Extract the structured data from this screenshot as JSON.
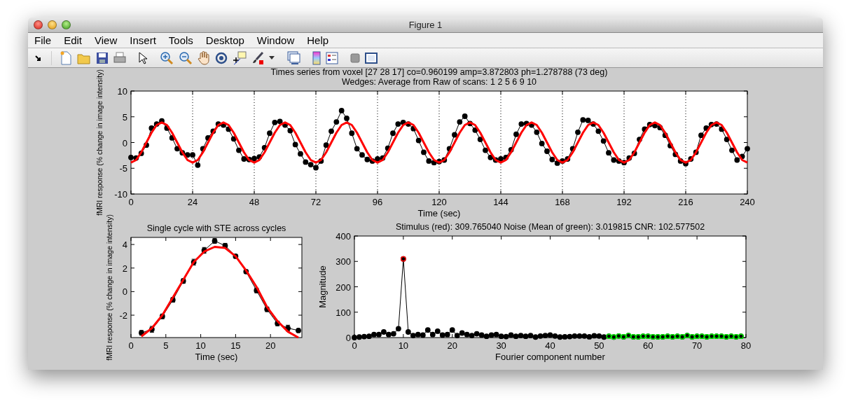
{
  "window": {
    "title": "Figure 1"
  },
  "menu": [
    "File",
    "Edit",
    "View",
    "Insert",
    "Tools",
    "Desktop",
    "Window",
    "Help"
  ],
  "figure": {
    "plots": [
      {
        "chart_data": {
          "type": "line",
          "title": [
            "Times series from voxel [27 28 17]  co=0.960199 amp=3.872803 ph=1.278788 (73 deg)",
            "Wedges: Average from Raw of scans: 1   2   5   6   9  10"
          ],
          "xlabel": "Time (sec)",
          "ylabel": "fMRI response (% change in image intensity)",
          "grid": "x",
          "xlim": [
            0,
            240
          ],
          "ylim": [
            -10,
            10
          ],
          "xticks": [
            0,
            24,
            48,
            72,
            96,
            120,
            144,
            168,
            192,
            216,
            240
          ],
          "yticks": [
            -10,
            -5,
            0,
            5,
            10
          ],
          "x": [
            0,
            2,
            4,
            6,
            8,
            10,
            12,
            14,
            16,
            18,
            20,
            22,
            24,
            26,
            28,
            30,
            32,
            34,
            36,
            38,
            40,
            42,
            44,
            46,
            48,
            50,
            52,
            54,
            56,
            58,
            60,
            62,
            64,
            66,
            68,
            70,
            72,
            74,
            76,
            78,
            80,
            82,
            84,
            86,
            88,
            90,
            92,
            94,
            96,
            98,
            100,
            102,
            104,
            106,
            108,
            110,
            112,
            114,
            116,
            118,
            120,
            122,
            124,
            126,
            128,
            130,
            132,
            134,
            136,
            138,
            140,
            142,
            144,
            146,
            148,
            150,
            152,
            154,
            156,
            158,
            160,
            162,
            164,
            166,
            168,
            170,
            172,
            174,
            176,
            178,
            180,
            182,
            184,
            186,
            188,
            190,
            192,
            194,
            196,
            198,
            200,
            202,
            204,
            206,
            208,
            210,
            212,
            214,
            216,
            218,
            220,
            222,
            224,
            226,
            228,
            230,
            232,
            234,
            236,
            238,
            240
          ],
          "series": [
            {
              "color": "#000000",
              "marker": "circle",
              "values": [
                -2.9,
                -3.0,
                -2.1,
                -0.5,
                2.8,
                3.6,
                4.2,
                2.8,
                0.9,
                -1.2,
                -2.0,
                -2.4,
                -2.4,
                -4.4,
                -1.2,
                0.9,
                2.2,
                3.6,
                3.4,
                2.6,
                0.7,
                -1.5,
                -3.2,
                -3.3,
                -3.1,
                -2.8,
                -1.0,
                1.8,
                3.9,
                4.1,
                3.4,
                2.3,
                -0.4,
                -2.2,
                -3.8,
                -4.3,
                -4.9,
                -3.6,
                -0.5,
                2.2,
                4.0,
                6.2,
                4.7,
                1.8,
                -1.2,
                -2.4,
                -3.3,
                -3.6,
                -3.2,
                -3.0,
                -1.1,
                1.8,
                3.6,
                3.9,
                3.6,
                2.7,
                0.4,
                -1.9,
                -3.6,
                -3.9,
                -3.7,
                -3.4,
                -1.2,
                1.5,
                4.0,
                5.1,
                3.7,
                2.4,
                0.6,
                -1.5,
                -2.9,
                -3.4,
                -3.2,
                -2.9,
                -1.4,
                1.6,
                3.6,
                3.7,
                3.4,
                2.0,
                -0.2,
                -1.7,
                -3.3,
                -4.0,
                -3.6,
                -3.2,
                -1.2,
                2.0,
                4.4,
                4.3,
                3.6,
                2.2,
                0.3,
                -2.0,
                -3.4,
                -3.6,
                -3.9,
                -3.0,
                -2.1,
                0.6,
                2.6,
                3.5,
                3.3,
                2.9,
                1.4,
                -0.6,
                -2.3,
                -3.6,
                -4.1,
                -3.2,
                -1.9,
                1.4,
                2.8,
                3.5,
                3.6,
                2.6,
                0.6,
                -1.5,
                -3.4,
                -2.7,
                -1.2
              ]
            },
            {
              "color": "#ff0000",
              "values": [
                -3.9,
                -3.4,
                -1.9,
                0,
                1.9,
                3.4,
                3.9,
                3.4,
                1.9,
                0,
                -1.9,
                -3.4,
                -3.9,
                -3.4,
                -1.9,
                0,
                1.9,
                3.4,
                3.9,
                3.4,
                1.9,
                0,
                -1.9,
                -3.4,
                -3.9,
                -3.4,
                -1.9,
                0,
                1.9,
                3.4,
                3.9,
                3.4,
                1.9,
                0,
                -1.9,
                -3.4,
                -3.9,
                -3.4,
                -1.9,
                0,
                1.9,
                3.4,
                3.9,
                3.4,
                1.9,
                0,
                -1.9,
                -3.4,
                -3.9,
                -3.4,
                -1.9,
                0,
                1.9,
                3.4,
                3.9,
                3.4,
                1.9,
                0,
                -1.9,
                -3.4,
                -3.9,
                -3.4,
                -1.9,
                0,
                1.9,
                3.4,
                3.9,
                3.4,
                1.9,
                0,
                -1.9,
                -3.4,
                -3.9,
                -3.4,
                -1.9,
                0,
                1.9,
                3.4,
                3.9,
                3.4,
                1.9,
                0,
                -1.9,
                -3.4,
                -3.9,
                -3.4,
                -1.9,
                0,
                1.9,
                3.4,
                3.9,
                3.4,
                1.9,
                0,
                -1.9,
                -3.4,
                -3.9,
                -3.4,
                -1.9,
                0,
                1.9,
                3.4,
                3.9,
                3.4,
                1.9,
                0,
                -1.9,
                -3.4,
                -3.9,
                -3.4,
                -1.9,
                0,
                1.9,
                3.4,
                3.9,
                3.4,
                1.9,
                0,
                -1.9,
                -3.4,
                -3.9
              ]
            }
          ]
        }
      },
      {
        "chart_data": {
          "type": "line",
          "title": "Single cycle with STE across cycles",
          "xlabel": "Time (sec)",
          "ylabel": "fMRI response (% change in image intensity)",
          "xlim": [
            0,
            24.5
          ],
          "ylim": [
            -3.9,
            4.6
          ],
          "xticks": [
            0,
            5,
            10,
            15,
            20
          ],
          "yticks": [
            -2,
            0,
            2,
            4
          ],
          "x": [
            1.5,
            3,
            4.5,
            6,
            7.5,
            9,
            10.5,
            12,
            13.5,
            15,
            16.5,
            18,
            19.5,
            21,
            22.5,
            24
          ],
          "series": [
            {
              "color": "#000000",
              "marker": "circle",
              "values": [
                -3.5,
                -3.2,
                -2.1,
                -0.7,
                0.9,
                2.5,
                3.5,
                4.3,
                3.9,
                3.0,
                1.7,
                0.1,
                -1.5,
                -2.7,
                -3.1,
                -3.3
              ],
              "errors": [
                0.2,
                0.25,
                0.2,
                0.2,
                0.2,
                0.25,
                0.25,
                0.2,
                0.2,
                0.15,
                0.15,
                0.2,
                0.2,
                0.2,
                0.25,
                0.15
              ]
            },
            {
              "color": "#ff0000",
              "values": [
                -3.8,
                -3.1,
                -2.0,
                -0.5,
                1.0,
                2.5,
                3.4,
                3.8,
                3.7,
                3.0,
                1.8,
                0.4,
                -1.3,
                -2.5,
                -3.4,
                -3.9
              ]
            }
          ]
        }
      },
      {
        "chart_data": {
          "type": "line",
          "title": "Stimulus (red): 309.765040 Noise (Mean of green): 3.019815 CNR: 102.577502",
          "xlabel": "Fourier component number",
          "ylabel": "Magnitude",
          "xlim": [
            0,
            80
          ],
          "ylim": [
            0,
            400
          ],
          "xticks": [
            0,
            10,
            20,
            30,
            40,
            50,
            60,
            70,
            80
          ],
          "yticks": [
            0,
            100,
            200,
            300,
            400
          ],
          "x": [
            0,
            1,
            2,
            3,
            4,
            5,
            6,
            7,
            8,
            9,
            10,
            11,
            12,
            13,
            14,
            15,
            16,
            17,
            18,
            19,
            20,
            21,
            22,
            23,
            24,
            25,
            26,
            27,
            28,
            29,
            30,
            31,
            32,
            33,
            34,
            35,
            36,
            37,
            38,
            39,
            40,
            41,
            42,
            43,
            44,
            45,
            46,
            47,
            48,
            49,
            50,
            51,
            52,
            53,
            54,
            55,
            56,
            57,
            58,
            59,
            60,
            61,
            62,
            63,
            64,
            65,
            66,
            67,
            68,
            69,
            70,
            71,
            72,
            73,
            74,
            75,
            76,
            77,
            78,
            79
          ],
          "series": [
            {
              "color": "#000000",
              "marker": "circle",
              "values": [
                0,
                2,
                4,
                5,
                12,
                12,
                22,
                12,
                15,
                35,
                310,
                22,
                8,
                12,
                10,
                30,
                12,
                25,
                10,
                12,
                30,
                8,
                18,
                12,
                8,
                15,
                10,
                5,
                10,
                12,
                5,
                4,
                10,
                5,
                8,
                5,
                8,
                2,
                6,
                8,
                10,
                6,
                2,
                3,
                4,
                6,
                6,
                6,
                3,
                7,
                6,
                2,
                5,
                2,
                6,
                3,
                8,
                3,
                3,
                5,
                5,
                3,
                3,
                3,
                5,
                3,
                5,
                3,
                8,
                3,
                5,
                5,
                3,
                5,
                5,
                5,
                3,
                5,
                3,
                5
              ]
            },
            {
              "color": "#ff0000",
              "marker": "circle",
              "x": [
                10
              ],
              "values": [
                310
              ]
            },
            {
              "color": "#00ee00",
              "marker": "circle",
              "x": [
                52,
                53,
                54,
                55,
                56,
                57,
                58,
                59,
                60,
                61,
                62,
                63,
                64,
                65,
                66,
                67,
                68,
                69,
                70,
                71,
                72,
                73,
                74,
                75,
                76,
                77,
                78,
                79
              ],
              "values": [
                5,
                2,
                6,
                3,
                8,
                3,
                3,
                5,
                5,
                3,
                3,
                3,
                5,
                3,
                5,
                3,
                8,
                3,
                5,
                5,
                3,
                5,
                5,
                5,
                3,
                5,
                3,
                5
              ]
            }
          ]
        }
      }
    ]
  }
}
